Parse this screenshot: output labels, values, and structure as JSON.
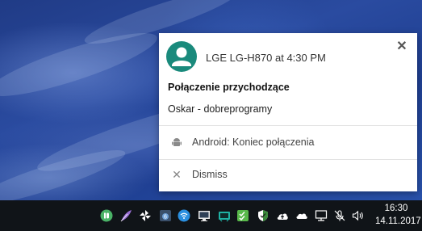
{
  "notification": {
    "source": "LGE LG-H870 at 4:30 PM",
    "title": "Połączenie przychodzące",
    "body": "Oskar - dobreprogramy",
    "close_icon": "close-icon",
    "avatar_icon": "person-avatar-icon",
    "avatar_color": "#1a8a7c",
    "actions": [
      {
        "icon": "android-icon",
        "label": "Android: Koniec połączenia"
      },
      {
        "icon": "close-icon",
        "label": "Dismiss"
      }
    ]
  },
  "taskbar": {
    "clock_time": "16:30",
    "clock_date": "14.11.2017",
    "background": "#101418",
    "tray_icons": [
      "pushbullet-icon",
      "feather-icon",
      "pinwheel-icon",
      "app-badge-icon",
      "wifi-blue-icon",
      "monitor-icon",
      "tv-icon",
      "checklist-icon",
      "shield-icon",
      "cloud-upload-icon",
      "onedrive-icon",
      "network-icon",
      "microphone-muted-icon",
      "volume-icon"
    ]
  }
}
